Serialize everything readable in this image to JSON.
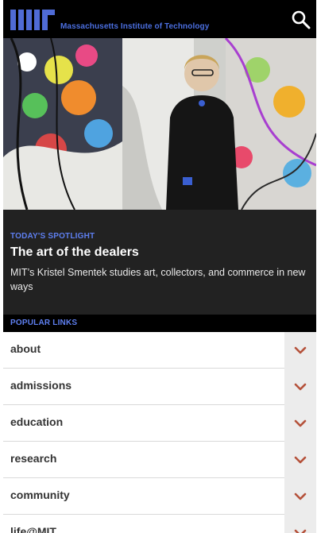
{
  "header": {
    "institution_name": "Massachusetts Institute of Technology",
    "logo_icon": "mit-logo-icon",
    "search_icon": "search-icon",
    "colors": {
      "background": "#000000",
      "brand_blue": "#4b6fe0"
    }
  },
  "hero": {
    "image_icon": "spotlight-photo"
  },
  "spotlight": {
    "kicker": "TODAY'S SPOTLIGHT",
    "headline": "The art of the dealers",
    "dek": "MIT’s Kristel Smentek studies art, collectors, and commerce in new ways",
    "colors": {
      "background": "#222222",
      "kicker": "#5e7ff0"
    }
  },
  "popular_links": {
    "heading": "POPULAR LINKS",
    "chevron_icon": "chevron-down-icon",
    "chevron_color": "#b5523b",
    "items": [
      {
        "label": "about"
      },
      {
        "label": "admissions"
      },
      {
        "label": "education"
      },
      {
        "label": "research"
      },
      {
        "label": "community"
      },
      {
        "label": "life@MIT"
      }
    ]
  }
}
